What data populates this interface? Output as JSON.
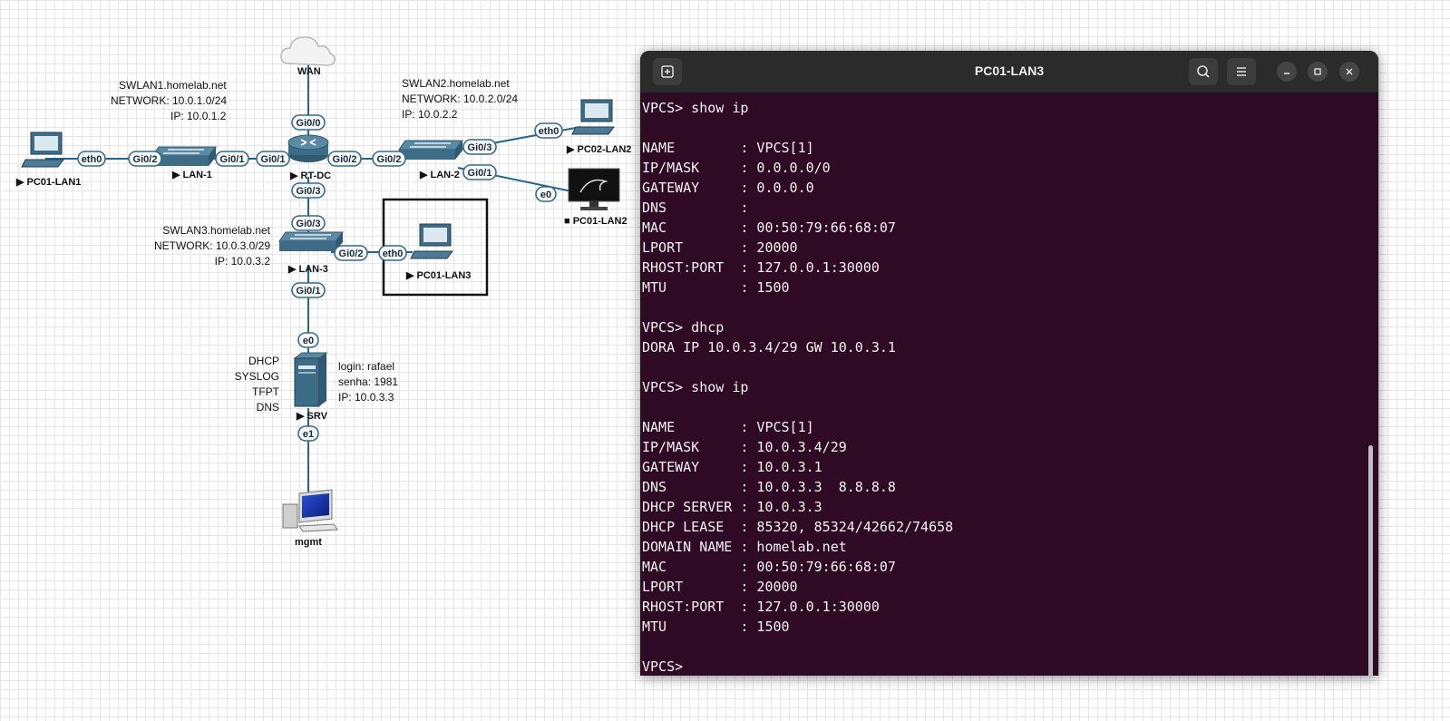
{
  "topology": {
    "wan_label": "WAN",
    "devices": {
      "rt_dc": "▶ RT-DC",
      "lan1": "▶ LAN-1",
      "lan2": "▶ LAN-2",
      "lan3": "▶ LAN-3",
      "pc01_lan1": "▶ PC01-LAN1",
      "pc02_lan2": "▶ PC02-LAN2",
      "pc01_lan2": "■ PC01-LAN2",
      "pc01_lan3": "▶ PC01-LAN3",
      "srv": "▶ SRV",
      "mgmt": "mgmt"
    },
    "ports": {
      "rt_gi00": "Gi0/0",
      "rt_gi01": "Gi0/1",
      "rt_gi02": "Gi0/2",
      "rt_gi03": "Gi0/3",
      "lan1_gi01": "Gi0/1",
      "lan1_gi02": "Gi0/2",
      "pc01lan1_eth0": "eth0",
      "lan2_gi02": "Gi0/2",
      "lan2_gi03": "Gi0/3",
      "lan2_gi01": "Gi0/1",
      "pc02lan2_eth0": "eth0",
      "pc01lan2_e0": "e0",
      "lan3_gi03": "Gi0/3",
      "lan3_gi02": "Gi0/2",
      "lan3_gi01": "Gi0/1",
      "pc01lan3_eth0": "eth0",
      "srv_e0": "e0",
      "srv_e1": "e1"
    },
    "notes": {
      "swlan1": [
        "SWLAN1.homelab.net",
        "NETWORK: 10.0.1.0/24",
        "IP: 10.0.1.2"
      ],
      "swlan2": [
        "SWLAN2.homelab.net",
        "NETWORK: 10.0.2.0/24",
        "IP: 10.0.2.2"
      ],
      "swlan3": [
        "SWLAN3.homelab.net",
        "NETWORK: 10.0.3.0/29",
        "IP: 10.0.3.2"
      ],
      "srv_services": [
        "DHCP",
        "SYSLOG",
        "TFPT",
        "DNS"
      ],
      "srv_login": [
        "login: rafael",
        "senha: 1981",
        "IP: 10.0.3.3"
      ]
    }
  },
  "terminal": {
    "title": "PC01-LAN3",
    "lines": [
      "VPCS> show ip",
      "",
      "NAME        : VPCS[1]",
      "IP/MASK     : 0.0.0.0/0",
      "GATEWAY     : 0.0.0.0",
      "DNS         :",
      "MAC         : 00:50:79:66:68:07",
      "LPORT       : 20000",
      "RHOST:PORT  : 127.0.0.1:30000",
      "MTU         : 1500",
      "",
      "VPCS> dhcp",
      "DORA IP 10.0.3.4/29 GW 10.0.3.1",
      "",
      "VPCS> show ip",
      "",
      "NAME        : VPCS[1]",
      "IP/MASK     : 10.0.3.4/29",
      "GATEWAY     : 10.0.3.1",
      "DNS         : 10.0.3.3  8.8.8.8",
      "DHCP SERVER : 10.0.3.3",
      "DHCP LEASE  : 85320, 85324/42662/74658",
      "DOMAIN NAME : homelab.net",
      "MAC         : 00:50:79:66:68:07",
      "LPORT       : 20000",
      "RHOST:PORT  : 127.0.0.1:30000",
      "MTU         : 1500",
      "",
      "VPCS> "
    ]
  },
  "colors": {
    "terminal_bg": "#2f0a24",
    "header_bg": "#2b2b2b",
    "link": "#1f6693",
    "device": "#3d6c86"
  }
}
